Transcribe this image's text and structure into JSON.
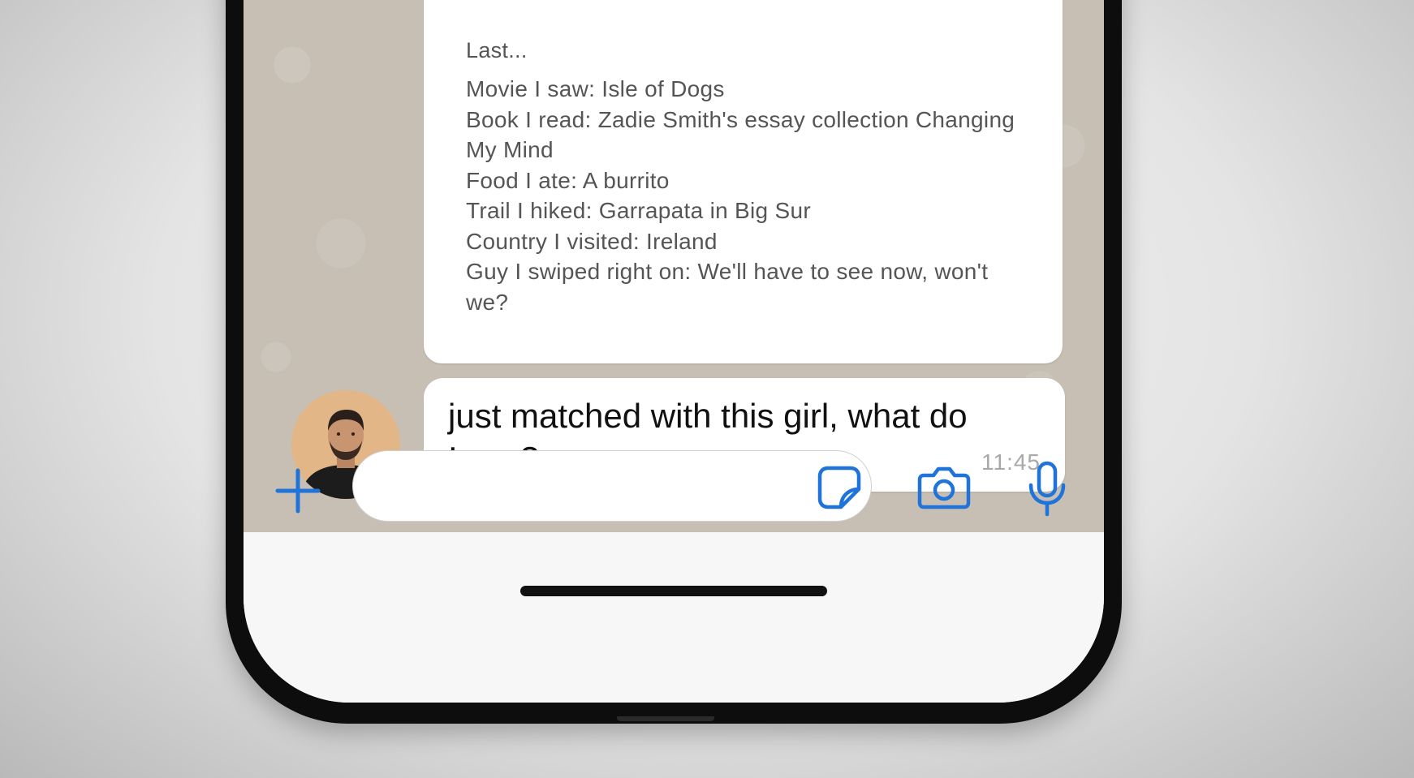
{
  "profile_card": {
    "heading": "Last...",
    "items": [
      "Movie I saw: Isle of Dogs",
      "Book I read: Zadie Smith's essay collection Changing My Mind",
      "Food I ate: A burrito",
      "Trail I hiked: Garrapata in Big Sur",
      "Country I visited: Ireland",
      "Guy I swiped right on: We'll have to see now, won't we?"
    ]
  },
  "message": {
    "text": "just matched with this girl, what do I say?",
    "time": "11:45"
  },
  "composer": {
    "value": "",
    "icons": [
      "plus-icon",
      "sticker-icon",
      "camera-icon",
      "microphone-icon"
    ]
  },
  "colors": {
    "accent": "#1f73d9",
    "chat_wallpaper": "#c7bfb4",
    "bubble": "#ffffff",
    "input_bar": "#f7f7f7"
  }
}
